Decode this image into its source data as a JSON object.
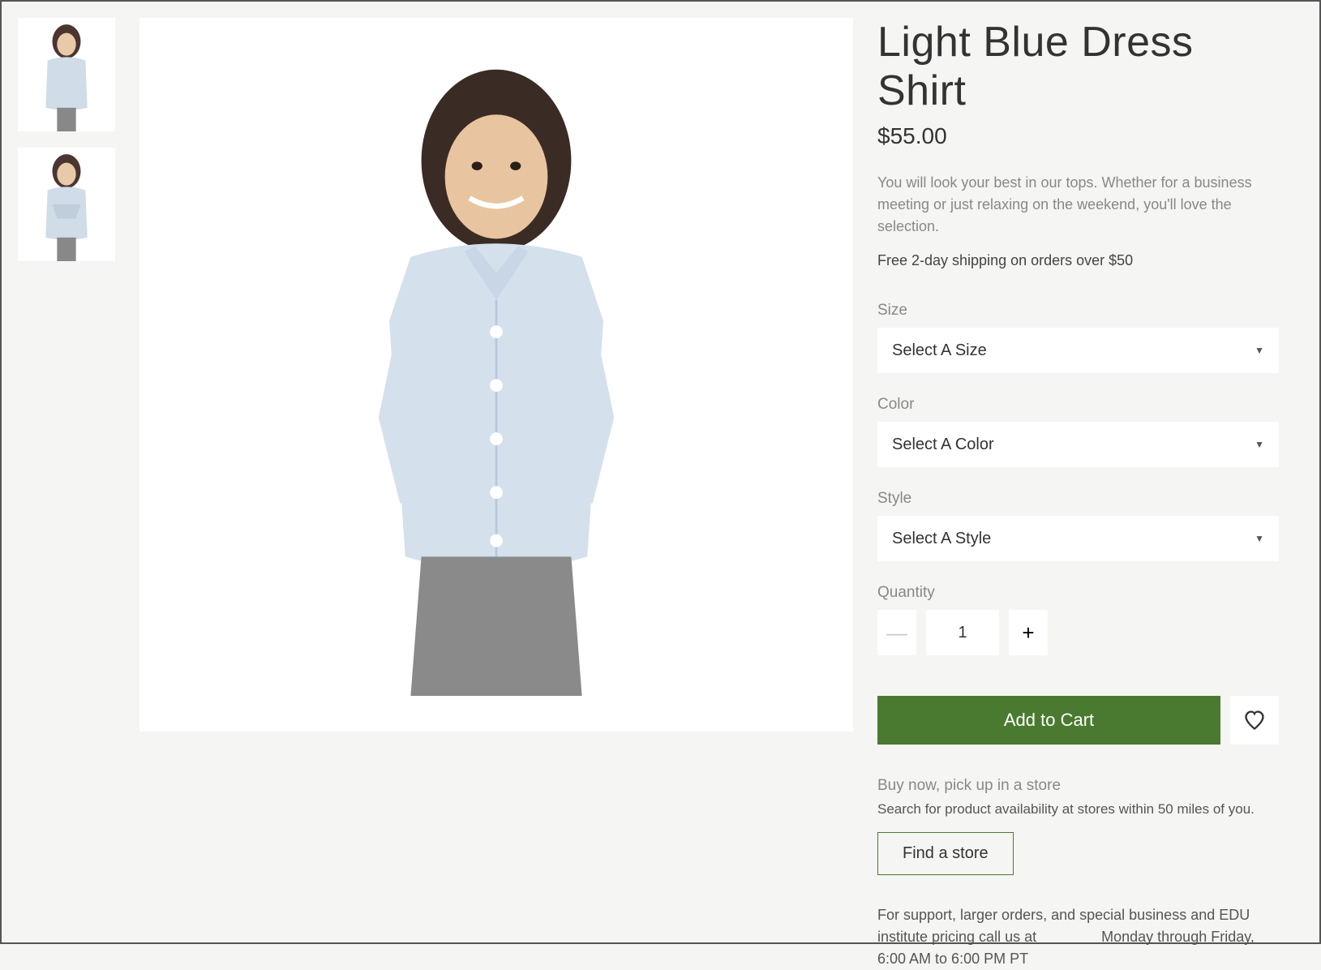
{
  "product": {
    "title": "Light Blue Dress Shirt",
    "price": "$55.00",
    "description": "You will look your best in our tops. Whether for a business meeting or just relaxing on the weekend, you'll love the selection.",
    "shipping_note": "Free 2-day shipping on orders over $50"
  },
  "options": {
    "size": {
      "label": "Size",
      "placeholder": "Select A Size"
    },
    "color": {
      "label": "Color",
      "placeholder": "Select A Color"
    },
    "style": {
      "label": "Style",
      "placeholder": "Select A Style"
    }
  },
  "quantity": {
    "label": "Quantity",
    "value": "1"
  },
  "actions": {
    "add_to_cart": "Add to Cart"
  },
  "pickup": {
    "title": "Buy now, pick up in a store",
    "description": "Search for product availability at stores within 50 miles of you.",
    "button": "Find a store"
  },
  "support": {
    "text_before": "For support, larger orders, and special business and EDU institute pricing call us at ",
    "text_after": " Monday through Friday, 6:00 AM to 6:00 PM PT"
  },
  "colors": {
    "accent": "#4a7a2f"
  }
}
